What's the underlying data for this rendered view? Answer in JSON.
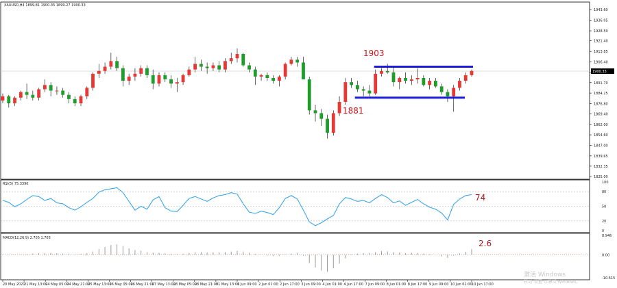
{
  "symbol_header": "XAUUSD,H4  1899.81 1900.35 1899.27 1900.33",
  "rsi_header": "RSI(5) 75.3390",
  "macd_header": "MACD(12,26,9) 2.705 1.705",
  "watermark": {
    "line1": "激活 Windows",
    "line2": "转到\"设置\"以激活 Windows。"
  },
  "colors": {
    "up": "#e53935",
    "down": "#1f9d2b",
    "level": "#1a1ad6",
    "rsi": "#3aa6ea",
    "macd": "#9a9a9a",
    "annotation": "#c8161d"
  },
  "price_axis": {
    "ticks": [
      "1943.60",
      "1936.05",
      "1928.50",
      "1921.40",
      "1913.85",
      "1906.40",
      "1899.00",
      "1891.70",
      "1884.25",
      "1876.80",
      "1869.40",
      "1862.00",
      "1854.60",
      "1847.00",
      "1839.65",
      "1832.35",
      "1825.00"
    ],
    "min": 1825.0,
    "max": 1943.6,
    "current_price_label": "1900.33"
  },
  "rsi_axis": {
    "ticks": [
      "100",
      "80",
      "50",
      "20",
      "0"
    ],
    "min": 0,
    "max": 100,
    "levels": [
      80,
      50,
      20
    ]
  },
  "macd_axis": {
    "ticks": [
      "8.946",
      "0.00",
      "-10.515"
    ],
    "min": -10.515,
    "max": 8.946
  },
  "time_axis": [
    "20 May 2021",
    "21 May 13:00",
    "24 May 05:00",
    "24 May 21:00",
    "25 May 13:00",
    "26 May 05:00",
    "26 May 21:00",
    "27 May 13:00",
    "28 May 05:00",
    "28 May 21:00",
    "31 May 13:00",
    "1 Jun 09:00",
    "2 Jun 01:00",
    "2 Jun 17:00",
    "3 Jun 09:00",
    "4 Jun 01:00",
    "4 Jun 17:00",
    "7 Jun 09:00",
    "8 Jun 01:00",
    "8 Jun 17:00",
    "9 Jun 09:00",
    "10 Jun 01:00",
    "10 Jun 17:00"
  ],
  "annotations": {
    "price_high": "1903",
    "price_low": "1881",
    "rsi_value": "74",
    "macd_value": "2.6"
  },
  "chart_data": [
    {
      "type": "candlestick",
      "title": "XAUUSD,H4",
      "ohlc": [
        [
          1879,
          1884,
          1877,
          1882
        ],
        [
          1882,
          1883,
          1874,
          1877
        ],
        [
          1877,
          1882,
          1875,
          1881
        ],
        [
          1881,
          1886,
          1879,
          1885
        ],
        [
          1885,
          1891,
          1880,
          1883
        ],
        [
          1883,
          1886,
          1879,
          1881
        ],
        [
          1881,
          1888,
          1879,
          1887
        ],
        [
          1887,
          1894,
          1885,
          1890
        ],
        [
          1890,
          1892,
          1882,
          1886
        ],
        [
          1886,
          1889,
          1883,
          1886
        ],
        [
          1886,
          1888,
          1881,
          1883
        ],
        [
          1883,
          1885,
          1877,
          1880
        ],
        [
          1880,
          1882,
          1875,
          1877
        ],
        [
          1877,
          1883,
          1875,
          1882
        ],
        [
          1882,
          1889,
          1880,
          1888
        ],
        [
          1888,
          1899,
          1886,
          1898
        ],
        [
          1898,
          1905,
          1895,
          1900
        ],
        [
          1900,
          1906,
          1898,
          1903
        ],
        [
          1903,
          1913,
          1901,
          1907
        ],
        [
          1907,
          1910,
          1900,
          1902
        ],
        [
          1902,
          1904,
          1889,
          1893
        ],
        [
          1893,
          1898,
          1890,
          1896
        ],
        [
          1896,
          1902,
          1893,
          1898
        ],
        [
          1898,
          1904,
          1896,
          1902
        ],
        [
          1902,
          1904,
          1895,
          1897
        ],
        [
          1897,
          1901,
          1887,
          1891
        ],
        [
          1891,
          1899,
          1889,
          1897
        ],
        [
          1897,
          1899,
          1892,
          1894
        ],
        [
          1894,
          1897,
          1888,
          1891
        ],
        [
          1891,
          1895,
          1885,
          1892
        ],
        [
          1892,
          1898,
          1890,
          1897
        ],
        [
          1897,
          1903,
          1896,
          1901
        ],
        [
          1901,
          1910,
          1899,
          1905
        ],
        [
          1905,
          1908,
          1900,
          1903
        ],
        [
          1903,
          1906,
          1898,
          1902
        ],
        [
          1902,
          1906,
          1900,
          1904
        ],
        [
          1904,
          1907,
          1899,
          1901
        ],
        [
          1901,
          1909,
          1899,
          1907
        ],
        [
          1907,
          1913,
          1905,
          1909
        ],
        [
          1909,
          1916,
          1906,
          1912
        ],
        [
          1912,
          1913,
          1903,
          1904
        ],
        [
          1904,
          1906,
          1899,
          1901
        ],
        [
          1901,
          1903,
          1890,
          1896
        ],
        [
          1896,
          1898,
          1893,
          1897
        ],
        [
          1897,
          1899,
          1893,
          1895
        ],
        [
          1895,
          1897,
          1891,
          1893
        ],
        [
          1893,
          1897,
          1889,
          1896
        ],
        [
          1896,
          1906,
          1894,
          1905
        ],
        [
          1905,
          1910,
          1904,
          1908
        ],
        [
          1908,
          1910,
          1903,
          1906
        ],
        [
          1906,
          1910,
          1899,
          1894
        ],
        [
          1894,
          1896,
          1869,
          1872
        ],
        [
          1872,
          1876,
          1864,
          1870
        ],
        [
          1870,
          1873,
          1861,
          1866
        ],
        [
          1866,
          1869,
          1852,
          1856
        ],
        [
          1856,
          1872,
          1854,
          1870
        ],
        [
          1870,
          1882,
          1868,
          1878
        ],
        [
          1878,
          1895,
          1876,
          1892
        ],
        [
          1892,
          1895,
          1888,
          1890
        ],
        [
          1890,
          1893,
          1885,
          1887
        ],
        [
          1887,
          1889,
          1882,
          1886
        ],
        [
          1886,
          1890,
          1882,
          1884
        ],
        [
          1884,
          1901,
          1883,
          1898
        ],
        [
          1898,
          1902,
          1896,
          1900
        ],
        [
          1900,
          1905,
          1898,
          1899
        ],
        [
          1899,
          1903,
          1889,
          1892
        ],
        [
          1892,
          1896,
          1887,
          1895
        ],
        [
          1895,
          1899,
          1891,
          1893
        ],
        [
          1893,
          1897,
          1890,
          1894
        ],
        [
          1894,
          1902,
          1891,
          1895
        ],
        [
          1895,
          1897,
          1889,
          1890
        ],
        [
          1890,
          1895,
          1887,
          1893
        ],
        [
          1893,
          1895,
          1888,
          1889
        ],
        [
          1889,
          1891,
          1883,
          1885
        ],
        [
          1885,
          1887,
          1878,
          1882
        ],
        [
          1882,
          1890,
          1871,
          1888
        ],
        [
          1888,
          1895,
          1886,
          1893
        ],
        [
          1893,
          1899,
          1891,
          1897
        ],
        [
          1897,
          1901,
          1896,
          1900
        ]
      ],
      "horizontal_levels": [
        1903,
        1881
      ],
      "ylim": [
        1825.0,
        1943.6
      ]
    },
    {
      "type": "line",
      "title": "RSI(5) 75.3390",
      "values": [
        62,
        58,
        49,
        55,
        64,
        72,
        70,
        62,
        66,
        57,
        55,
        47,
        42,
        49,
        58,
        66,
        79,
        84,
        86,
        88,
        78,
        60,
        42,
        50,
        44,
        63,
        70,
        47,
        40,
        39,
        52,
        66,
        70,
        65,
        60,
        67,
        72,
        74,
        78,
        75,
        55,
        38,
        35,
        40,
        37,
        33,
        47,
        66,
        72,
        65,
        42,
        18,
        10,
        16,
        24,
        31,
        55,
        68,
        65,
        60,
        62,
        57,
        66,
        74,
        68,
        57,
        61,
        52,
        58,
        64,
        55,
        48,
        44,
        36,
        22,
        54,
        65,
        72,
        74
      ],
      "ylim": [
        0,
        100
      ]
    },
    {
      "type": "bar",
      "title": "MACD(12,26,9) 2.705 1.705",
      "values": [
        0.2,
        0.1,
        -0.1,
        0.1,
        0.3,
        0.6,
        0.8,
        0.8,
        0.9,
        0.8,
        0.6,
        0.5,
        0.3,
        0.4,
        0.8,
        1.5,
        2.6,
        3.6,
        4.5,
        4.8,
        4.0,
        3.0,
        2.2,
        1.9,
        1.3,
        1.0,
        1.0,
        0.7,
        0.4,
        0.3,
        0.5,
        0.9,
        1.2,
        1.3,
        1.0,
        1.1,
        1.2,
        1.3,
        1.5,
        1.8,
        1.5,
        0.9,
        0.4,
        0.0,
        -0.3,
        -0.6,
        -0.5,
        0.1,
        0.6,
        0.9,
        -0.4,
        -3.8,
        -5.8,
        -7.2,
        -7.8,
        -6.2,
        -4.0,
        -1.6,
        -0.2,
        0.6,
        0.8,
        0.9,
        1.3,
        1.7,
        1.6,
        1.3,
        1.1,
        0.8,
        0.9,
        0.9,
        0.6,
        0.3,
        0.0,
        -0.7,
        -1.4,
        -0.4,
        0.6,
        1.4,
        2.6
      ],
      "ylim": [
        -10.515,
        8.946
      ]
    }
  ]
}
